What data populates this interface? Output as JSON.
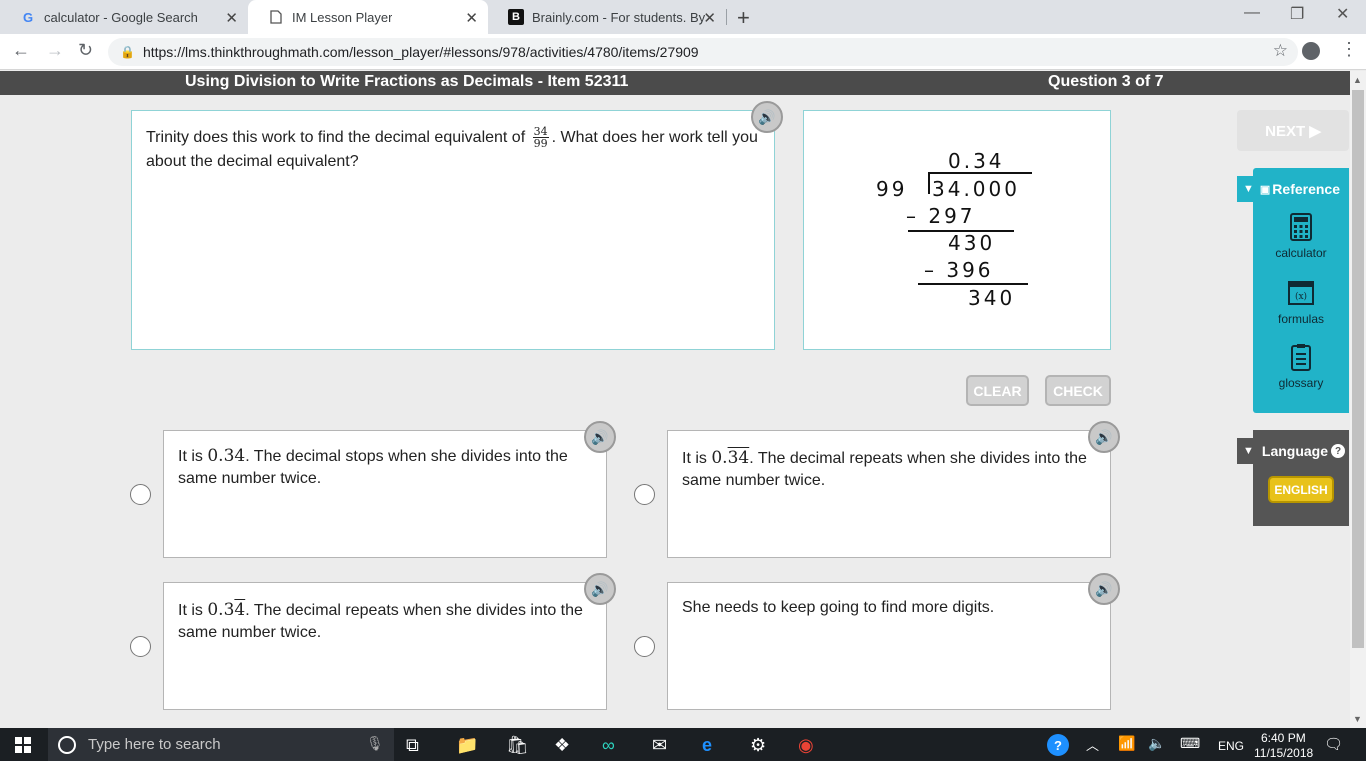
{
  "browser": {
    "tabs": [
      {
        "label": "calculator - Google Search",
        "icon": "G"
      },
      {
        "label": "IM Lesson Player",
        "icon": "page"
      },
      {
        "label": "Brainly.com - For students. By stu",
        "icon": "B"
      }
    ],
    "url": "https://lms.thinkthroughmath.com/lesson_player/#lessons/978/activities/4780/items/27909"
  },
  "lesson": {
    "title": "Using Division to Write Fractions as Decimals - Item 52311",
    "question_count": "Question 3 of 7",
    "prompt_before": "Trinity does this work to find the decimal equivalent of",
    "prompt_after": ". What does her work tell you about the decimal equivalent?",
    "fraction": {
      "numerator": "34",
      "denominator": "99"
    },
    "long_division": {
      "quotient": "0.34",
      "divisor": "99",
      "dividend": "34.000",
      "step1": "– 297",
      "rem1": "430",
      "step2": "– 396",
      "rem2": "340"
    },
    "buttons": {
      "clear": "CLEAR",
      "check": "CHECK",
      "next": "NEXT ▶"
    },
    "choices": [
      {
        "pre": "It is ",
        "math": "0.34",
        "post": ". The decimal stops when she divides into the same number twice."
      },
      {
        "pre": "It is ",
        "math_plain": "0.",
        "math_bar": "34",
        "post": ". The decimal repeats when she divides into the same number twice."
      },
      {
        "pre": "It is ",
        "math_plain": "0.3",
        "math_bar": "4",
        "post": ". The decimal repeats when she divides into the same number twice."
      },
      {
        "text": "She needs to keep going to find more digits."
      }
    ]
  },
  "sidebar": {
    "reference_label": "Reference",
    "items": [
      "calculator",
      "formulas",
      "glossary"
    ],
    "language_label": "Language",
    "language_button": "ENGLISH"
  },
  "taskbar": {
    "search_placeholder": "Type here to search",
    "lang": "ENG",
    "time": "6:40 PM",
    "date": "11/15/2018"
  }
}
